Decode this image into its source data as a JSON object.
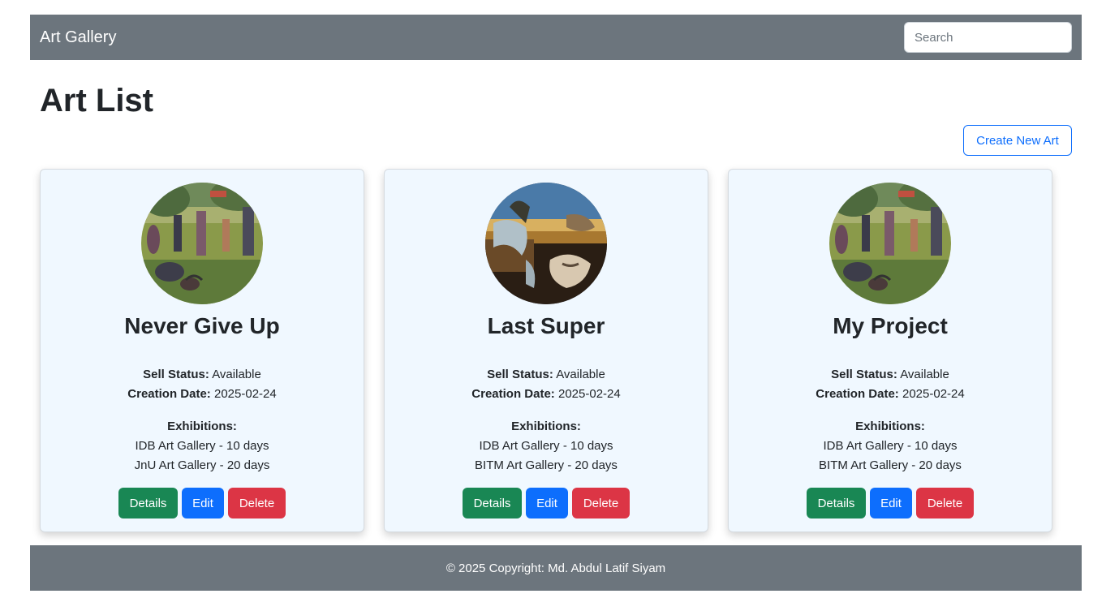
{
  "navbar": {
    "brand": "Art Gallery",
    "search_placeholder": "Search"
  },
  "page": {
    "title": "Art List",
    "create_button": "Create New Art"
  },
  "labels": {
    "sell_status": "Sell Status:",
    "creation_date": "Creation Date:",
    "exhibitions": "Exhibitions:",
    "details": "Details",
    "edit": "Edit",
    "delete": "Delete"
  },
  "arts": [
    {
      "title": "Never Give Up",
      "image": "seurat-park-painting",
      "sell_status": "Available",
      "creation_date": "2025-02-24",
      "exhibitions": [
        "IDB Art Gallery - 10 days",
        "JnU Art Gallery - 20 days"
      ]
    },
    {
      "title": "Last Super",
      "image": "melting-clocks-painting",
      "sell_status": "Available",
      "creation_date": "2025-02-24",
      "exhibitions": [
        "IDB Art Gallery - 10 days",
        "BITM Art Gallery - 20 days"
      ]
    },
    {
      "title": "My Project",
      "image": "seurat-park-painting",
      "sell_status": "Available",
      "creation_date": "2025-02-24",
      "exhibitions": [
        "IDB Art Gallery - 10 days",
        "BITM Art Gallery - 20 days"
      ]
    }
  ],
  "footer": {
    "text": "© 2025 Copyright: Md. Abdul Latif Siyam"
  },
  "colors": {
    "navbar_bg": "#6c757d",
    "card_bg": "#f0f8ff",
    "details": "#198754",
    "edit": "#0d6efd",
    "delete": "#dc3545"
  }
}
